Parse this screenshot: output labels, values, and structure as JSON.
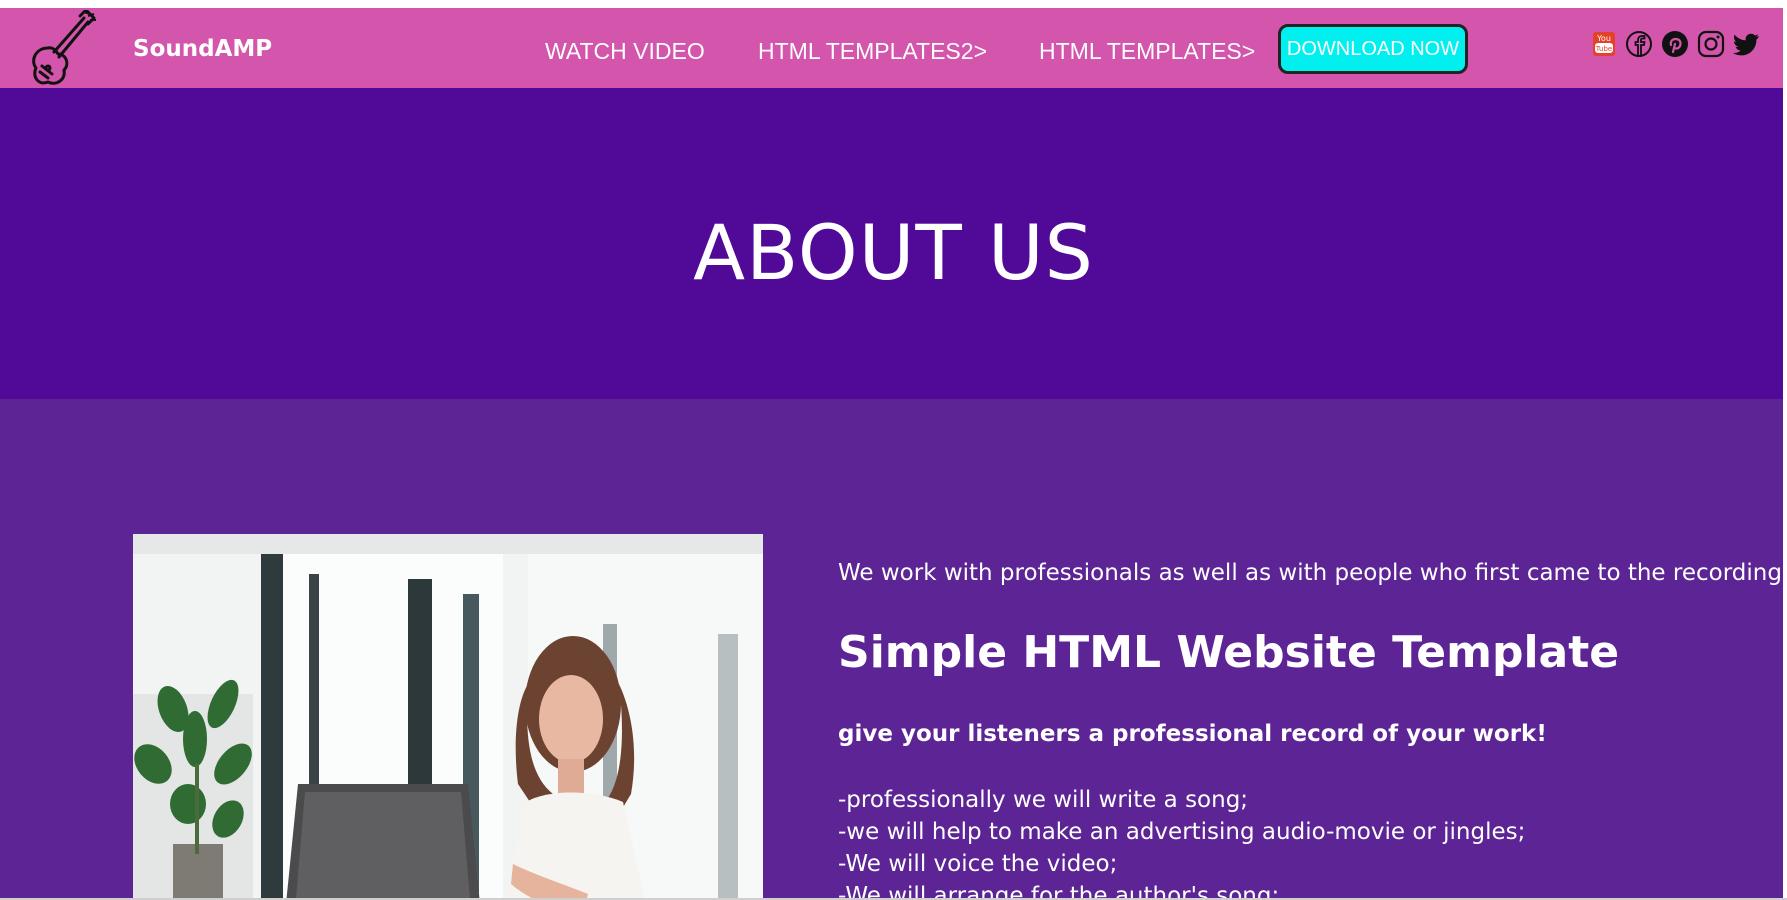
{
  "brand": {
    "name": "SoundAMP",
    "logo_icon": "guitar-icon"
  },
  "nav": {
    "links": [
      {
        "label": "WATCH VIDEO"
      },
      {
        "label": "HTML TEMPLATES2>"
      },
      {
        "label": "HTML TEMPLATES>"
      }
    ],
    "download_label": "DOWNLOAD NOW"
  },
  "social": [
    {
      "icon": "youtube-icon"
    },
    {
      "icon": "facebook-icon"
    },
    {
      "icon": "pinterest-icon"
    },
    {
      "icon": "instagram-icon"
    },
    {
      "icon": "twitter-icon"
    }
  ],
  "hero": {
    "title": "ABOUT US"
  },
  "about": {
    "intro": "We work with professionals as well as with people who first came to the recording studio.",
    "heading": "Simple HTML Website Template",
    "subheading": "give your listeners a professional record of your work!",
    "services": [
      "-professionally we will write a song;",
      "-we will help to make an advertising audio-movie or jingles;",
      "-We will voice the video;",
      "-We will arrange for the author's song;"
    ]
  },
  "colors": {
    "navbar": "#d455ac",
    "hero": "#510a98",
    "about": "#5c2494",
    "download_button": "#00f0f0"
  }
}
